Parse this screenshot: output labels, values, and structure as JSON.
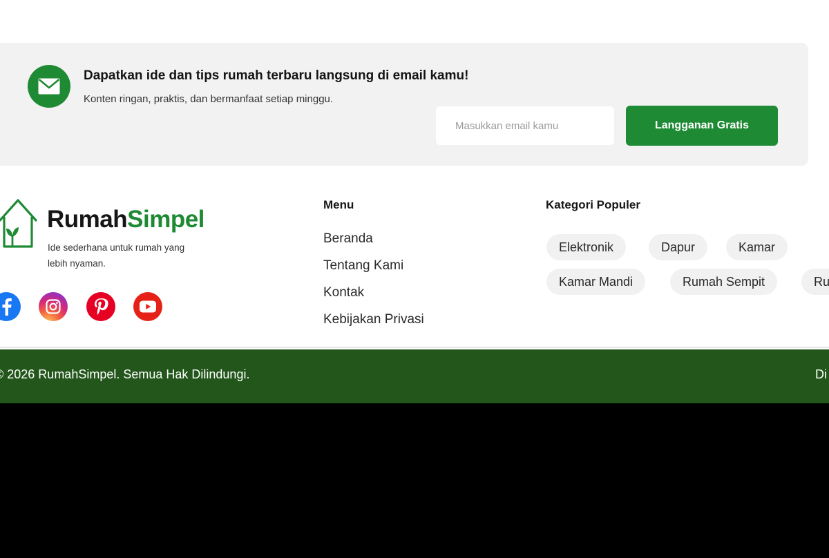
{
  "newsletter": {
    "title": "Dapatkan ide dan tips rumah terbaru langsung di email kamu!",
    "subtitle": "Konten ringan, praktis, dan bermanfaat setiap minggu.",
    "email_placeholder": "Masukkan email kamu",
    "email_value": "",
    "subscribe_label": "Langganan Gratis",
    "icon": "mail-icon"
  },
  "brand": {
    "name_part1": "Rumah",
    "name_part2": "Simpel",
    "tagline": "Ide sederhana untuk rumah yang lebih nyaman.",
    "logo_icon": "house-leaf-icon"
  },
  "socials": [
    {
      "icon": "facebook-icon"
    },
    {
      "icon": "instagram-icon"
    },
    {
      "icon": "pinterest-icon"
    },
    {
      "icon": "youtube-icon"
    }
  ],
  "menu": {
    "title": "Menu",
    "items": [
      "Beranda",
      "Tentang Kami",
      "Kontak",
      "Kebijakan Privasi"
    ]
  },
  "categories": {
    "title": "Kategori Populer",
    "items": [
      "Elektronik",
      "Dapur",
      "Kamar",
      "Kamar Mandi",
      "Rumah Sempit",
      "Ru"
    ]
  },
  "footer": {
    "copyright": "© 2026 RumahSimpel. Semua Hak Dilindungi.",
    "right_text": "Di"
  },
  "colors": {
    "accent": "#1f8a34",
    "footer_bar": "#22561a",
    "banner_bg": "#f1f2f1",
    "chip_bg": "#f0f1f0"
  }
}
